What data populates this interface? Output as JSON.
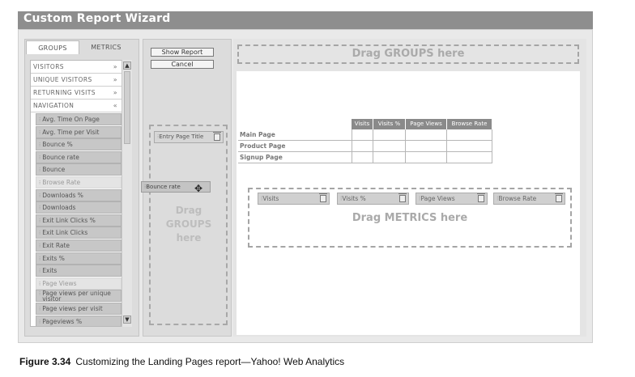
{
  "window": {
    "title": "Custom Report Wizard"
  },
  "tabs": [
    {
      "label": "GROUPS"
    },
    {
      "label": "METRICS"
    }
  ],
  "groups": [
    {
      "label": "VISITORS",
      "chevron": "»"
    },
    {
      "label": "UNIQUE VISITORS",
      "chevron": "»"
    },
    {
      "label": "RETURNING VISITS",
      "chevron": "»"
    },
    {
      "label": "NAVIGATION",
      "chevron": "«"
    }
  ],
  "metrics": [
    {
      "label": "Avg. Time On Page",
      "dimmed": false
    },
    {
      "label": "Avg. Time per Visit",
      "dimmed": false
    },
    {
      "label": "Bounce %",
      "dimmed": false
    },
    {
      "label": "Bounce rate",
      "dimmed": false
    },
    {
      "label": "Bounce",
      "dimmed": false
    },
    {
      "label": "Browse Rate",
      "dimmed": true
    },
    {
      "label": "Downloads %",
      "dimmed": false
    },
    {
      "label": "Downloads",
      "dimmed": false
    },
    {
      "label": "Exit Link Clicks %",
      "dimmed": false
    },
    {
      "label": "Exit Link Clicks",
      "dimmed": false
    },
    {
      "label": "Exit Rate",
      "dimmed": false
    },
    {
      "label": "Exits %",
      "dimmed": false
    },
    {
      "label": "Exits",
      "dimmed": false
    },
    {
      "label": "Page Views",
      "dimmed": true
    },
    {
      "label": "Page views per unique visitor",
      "dimmed": false
    },
    {
      "label": "Page views per visit",
      "dimmed": false
    },
    {
      "label": "Pageviews %",
      "dimmed": false
    }
  ],
  "buttons": {
    "show_report": "Show Report",
    "cancel": "Cancel"
  },
  "drop_zones": {
    "groups_top": "Drag GROUPS here",
    "groups_left": [
      "Drag",
      "GROUPS",
      "here"
    ],
    "metrics": "Drag METRICS here"
  },
  "left_group_chip": "Entry Page Title",
  "dragging_chip": "Bounce rate",
  "table": {
    "columns": [
      "Visits",
      "Visits %",
      "Page Views",
      "Browse Rate"
    ],
    "rows": [
      "Main Page",
      "Product Page",
      "Signup Page"
    ]
  },
  "metric_chips": [
    "Visits",
    "Visits %",
    "Page Views",
    "Browse Rate"
  ],
  "caption": {
    "figure": "Figure 3.34",
    "text": "Customizing the Landing Pages report—Yahoo! Web Analytics"
  }
}
